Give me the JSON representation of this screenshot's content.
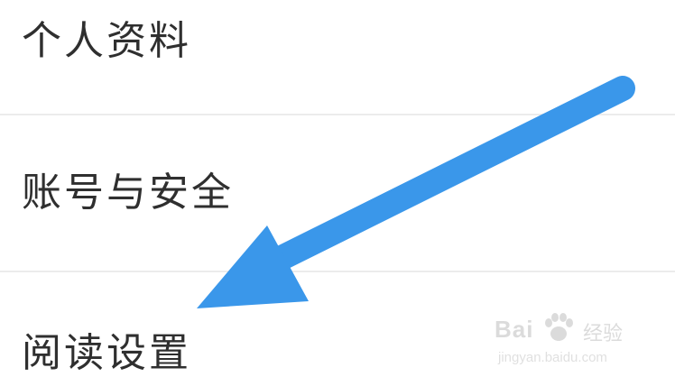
{
  "menu": {
    "items": [
      {
        "label": "个人资料"
      },
      {
        "label": "账号与安全"
      },
      {
        "label": "阅读设置"
      }
    ]
  },
  "annotation": {
    "type": "arrow",
    "color": "#3a97ea",
    "points_to": "阅读设置"
  },
  "watermark": {
    "brand": "Bai",
    "brand_suffix": "经验",
    "url": "jingyan.baidu.com",
    "icon": "paw-icon"
  }
}
